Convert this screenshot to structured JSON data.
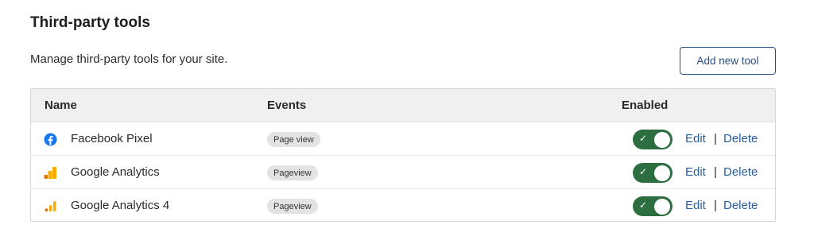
{
  "header": {
    "title": "Third-party tools",
    "description": "Manage third-party tools for your site.",
    "add_button_label": "Add new tool"
  },
  "table": {
    "columns": {
      "name": "Name",
      "events": "Events",
      "enabled": "Enabled"
    },
    "rows": [
      {
        "name": "Facebook Pixel",
        "icon": "facebook-icon",
        "event": "Page view",
        "enabled": true,
        "edit_label": "Edit",
        "separator": "|",
        "delete_label": "Delete"
      },
      {
        "name": "Google Analytics",
        "icon": "google-analytics-icon",
        "event": "Pageview",
        "enabled": true,
        "edit_label": "Edit",
        "separator": "|",
        "delete_label": "Delete"
      },
      {
        "name": "Google Analytics 4",
        "icon": "google-analytics-4-icon",
        "event": "Pageview",
        "enabled": true,
        "edit_label": "Edit",
        "separator": "|",
        "delete_label": "Delete"
      }
    ]
  },
  "colors": {
    "toggle_on": "#2c6e3f",
    "link": "#2a5e9c",
    "button_border": "#2a4f7f",
    "facebook_blue": "#1877f2",
    "analytics_orange": "#f9ab00",
    "analytics_dark_orange": "#e37400"
  }
}
